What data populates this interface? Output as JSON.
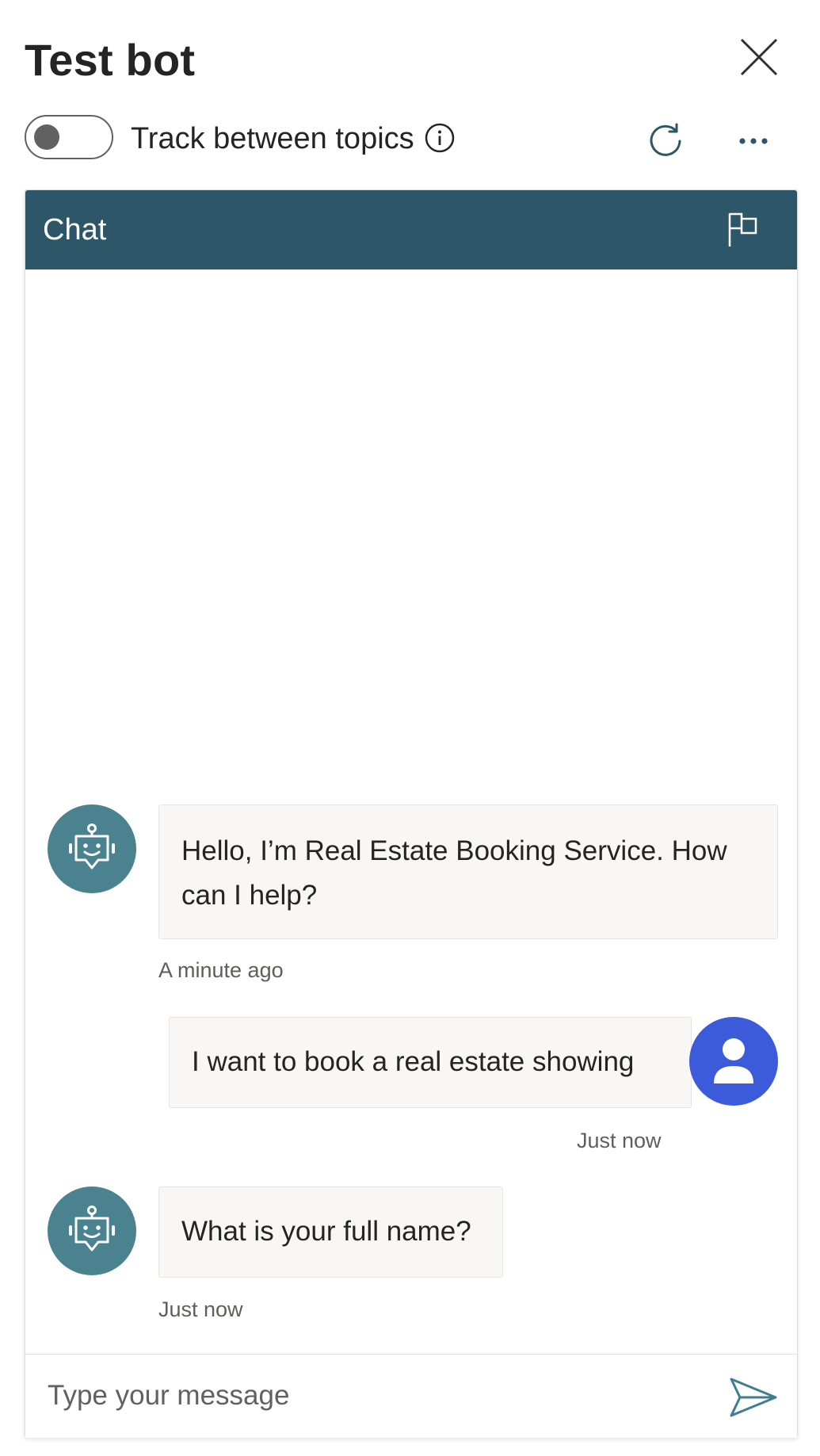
{
  "panel": {
    "title": "Test bot"
  },
  "toolbar": {
    "track_label": "Track between topics",
    "track_enabled": false
  },
  "chat": {
    "title": "Chat",
    "messages": [
      {
        "sender": "bot",
        "text": "Hello, I’m Real Estate Booking Service. How can I help?",
        "timestamp": "A minute ago"
      },
      {
        "sender": "user",
        "text": "I want to book a real estate showing",
        "timestamp": "Just now"
      },
      {
        "sender": "bot",
        "text": "What is your full name?",
        "timestamp": "Just now"
      }
    ],
    "input": {
      "placeholder": "Type your message",
      "value": ""
    }
  },
  "colors": {
    "chat_header": "#2e5669",
    "bot_avatar": "#4a8290",
    "user_avatar": "#3b5bdb",
    "bubble_bg": "#f8f7f6"
  },
  "icons": {
    "close": "close-icon",
    "info": "info-icon",
    "refresh": "refresh-icon",
    "more": "more-options-icon",
    "flag": "flag-icon",
    "bot": "bot-icon",
    "user": "person-icon",
    "send": "send-icon"
  }
}
